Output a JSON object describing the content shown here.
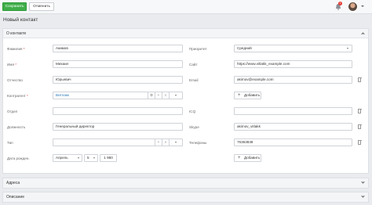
{
  "toolbar": {
    "save_label": "Сохранить",
    "cancel_label": "Отменить",
    "notification_count": "1"
  },
  "page_title": "Новый контакт",
  "section_about": {
    "title": "О контакте"
  },
  "labels": {
    "surname": "Фамилия",
    "name": "Имя",
    "patronymic": "Отчество",
    "account": "Контрагент",
    "department": "Отдел",
    "position": "Должность",
    "type": "Тип",
    "birthdate": "Дата рожден.",
    "priority": "Приоритет",
    "site": "Сайт",
    "email": "Email",
    "icq": "ICQ",
    "skype": "Skype",
    "phones": "Телефоны"
  },
  "values": {
    "surname": "Акимов",
    "name": "Михаил",
    "patronymic": "Юрьевич",
    "account": "Витлакк",
    "department": "",
    "position": "Генеральный директор",
    "type": "",
    "birth_month": "Апрель",
    "birth_day": "5",
    "birth_year": "1 980",
    "priority": "Средний",
    "site": "https://www.vitlakk_example.com",
    "email": "akimov@example.com",
    "icq": "",
    "skype": "akimov_vitlakk",
    "phone": "76363838"
  },
  "add_label": "Добавить",
  "section_address": {
    "title": "Адреса"
  },
  "section_description": {
    "title": "Описание"
  }
}
